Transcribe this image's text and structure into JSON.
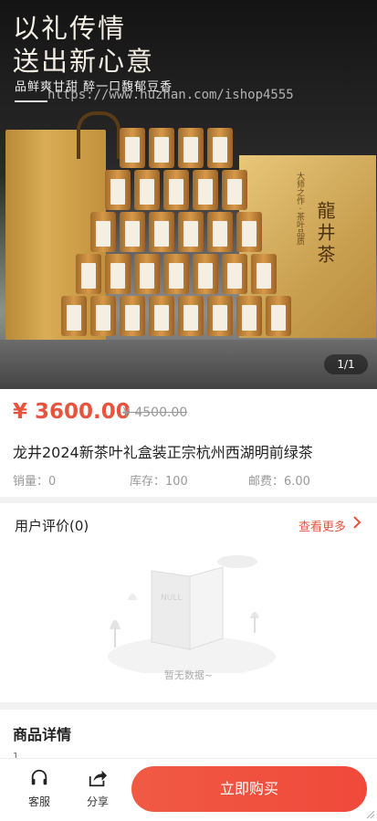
{
  "hero": {
    "headline_1": "以礼传情",
    "headline_2": "送出新心意",
    "tagline": "品鲜爽甘甜 醉一口馥郁豆香",
    "watermark": "https://www.huzhan.com/ishop4555",
    "box_label": "龍井茶",
    "box_small": "大师之作 · 茶叶品质",
    "counter": "1/1"
  },
  "product": {
    "price": "¥ 3600.00",
    "old_price": "¥ 4500.00",
    "title": "龙井2024新茶叶礼盒装正宗杭州西湖明前绿茶",
    "sales": "销量：0",
    "stock": "库存：100",
    "shipping": "邮费：6.00",
    "price_color": "#e8533f"
  },
  "reviews": {
    "title": "用户评价(0)",
    "more": "查看更多",
    "empty_text": "暂无数据~",
    "empty_book_text": "NULL"
  },
  "details": {
    "title": "商品详情",
    "content": "1"
  },
  "bottom_bar": {
    "service_label": "客服",
    "share_label": "分享",
    "buy_label": "立即购买",
    "service_icon": "headset-icon",
    "share_icon": "share-icon"
  }
}
